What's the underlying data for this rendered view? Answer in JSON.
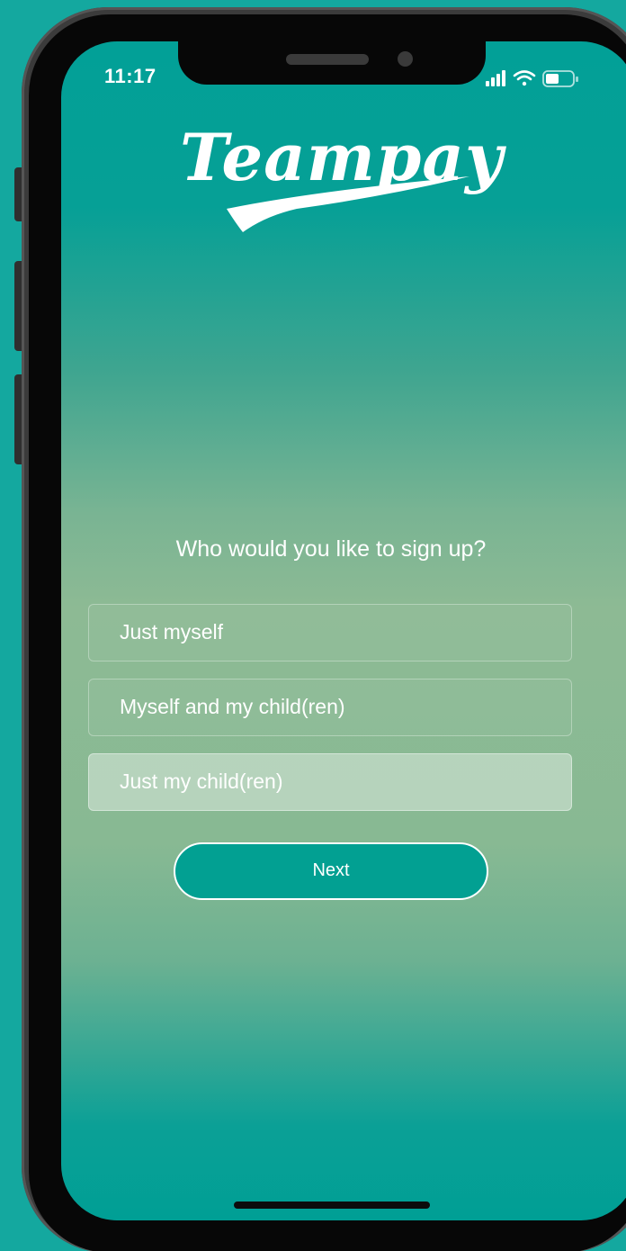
{
  "status_bar": {
    "time": "11:17",
    "signal_icon": "cellular-signal-icon",
    "wifi_icon": "wifi-icon",
    "battery_icon": "battery-icon"
  },
  "brand": {
    "logo_text": "Teampay"
  },
  "signup": {
    "question": "Who would you like to sign up?",
    "options": [
      {
        "label": "Just myself",
        "selected": false
      },
      {
        "label": "Myself and my child(ren)",
        "selected": false
      },
      {
        "label": "Just my child(ren)",
        "selected": true
      }
    ],
    "next_label": "Next"
  },
  "colors": {
    "background": "#14a89f",
    "accent": "#02a092",
    "text": "#ffffff"
  }
}
